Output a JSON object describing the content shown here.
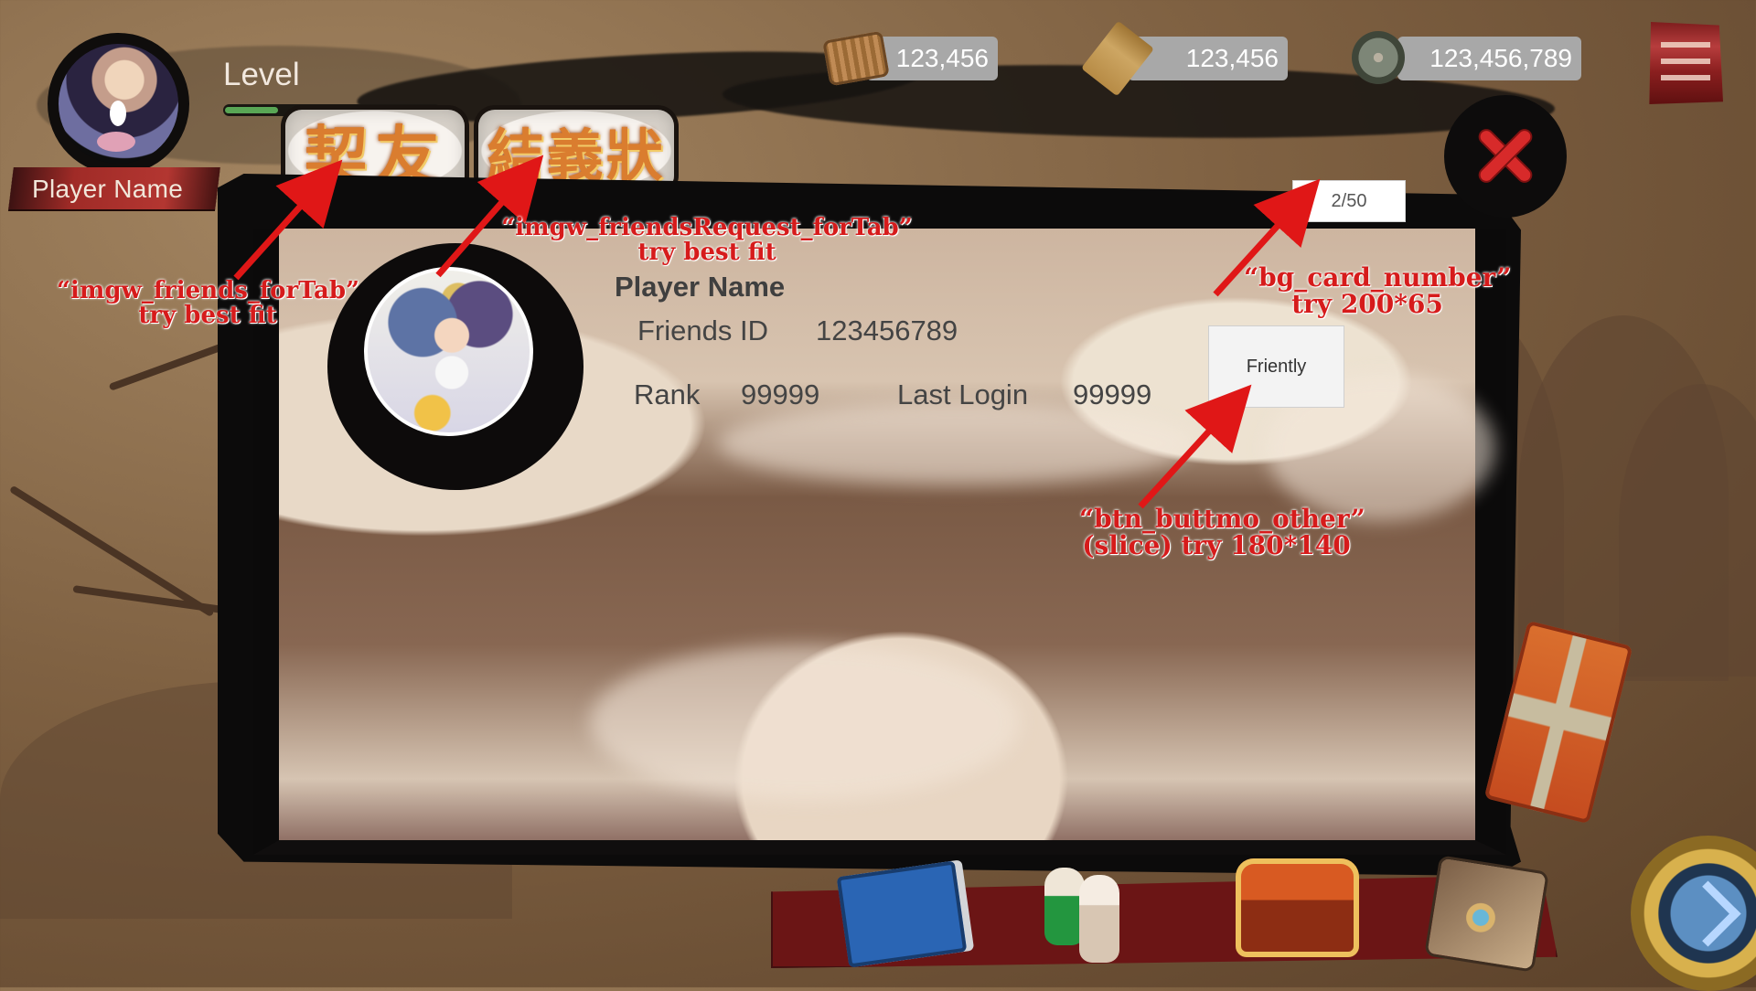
{
  "top_bar": {
    "level_label": "Level",
    "player_name": "Player Name",
    "stats": [
      {
        "value": "123,456",
        "icon": "scroll-icon"
      },
      {
        "value": "123,456",
        "icon": "plank-icon"
      },
      {
        "value": "123,456,789",
        "icon": "jade-coin-icon"
      }
    ]
  },
  "tabs": [
    {
      "label": "契友"
    },
    {
      "label": "結義狀"
    }
  ],
  "card_counter": "2/50",
  "friend_card": {
    "name": "Player Name",
    "friends_id_label": "Friends ID",
    "friends_id_value": "123456789",
    "rank_label": "Rank",
    "rank_value": "99999",
    "last_login_label": "Last Login",
    "last_login_value": "99999",
    "action_label": "Friently"
  },
  "annotations": {
    "friends_tab_line1": "“imgw_friends_forTab”",
    "friends_tab_line2": "try best fit",
    "request_tab_line1": "“imgw_friendsRequest_forTab”",
    "request_tab_line2": "try best fit",
    "card_number_line1": "“bg_card_number”",
    "card_number_line2": "try 200*65",
    "button_line1": "“btn_buttmo_other”",
    "button_line2": "(slice) try 180*140"
  },
  "colors": {
    "annotation_red": "#d61b1b",
    "tab_text": "#da7d2f",
    "close_red": "#d72a2a"
  }
}
